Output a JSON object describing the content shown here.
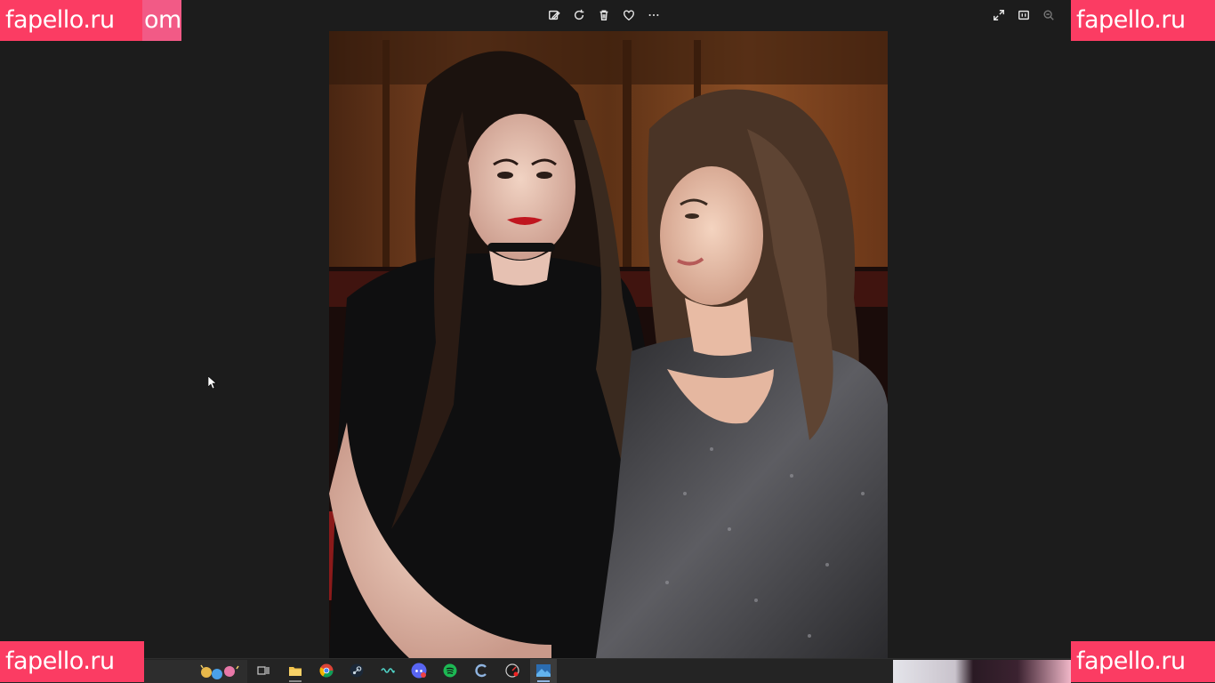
{
  "app": {
    "name": "Photos viewer"
  },
  "toolbar": {
    "left_actions": [
      {
        "name": "edit-image"
      },
      {
        "name": "rotate"
      },
      {
        "name": "delete"
      },
      {
        "name": "favorite"
      },
      {
        "name": "more-options"
      }
    ],
    "right_actions": [
      {
        "name": "full-screen"
      },
      {
        "name": "actual-size"
      },
      {
        "name": "zoom-out"
      }
    ]
  },
  "watermarks": {
    "top_left": "fapello.ru",
    "top_left_extra": "om",
    "top_right": "fapello.ru",
    "bottom_left": "fapello.ru",
    "bottom_right": "fapello.ru"
  },
  "taskbar": {
    "apps": [
      "task-view",
      "file-explorer",
      "chrome",
      "steam",
      "wavy-app",
      "discord",
      "spotify",
      "ccleaner",
      "speed-app",
      "photos"
    ],
    "active_app": "photos"
  },
  "colors": {
    "background": "#1c1c1c",
    "watermark": "#fb3c63",
    "taskbar": "#242424"
  }
}
